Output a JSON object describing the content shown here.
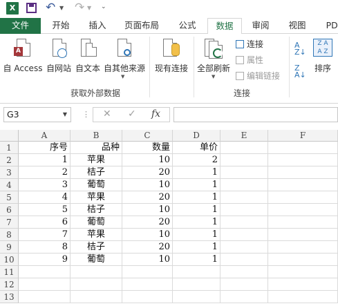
{
  "qat": {
    "logo": "X",
    "customize_glyph": "⌄"
  },
  "tabs": [
    {
      "label": "文件"
    },
    {
      "label": "开始"
    },
    {
      "label": "插入"
    },
    {
      "label": "页面布局"
    },
    {
      "label": "公式"
    },
    {
      "label": "数据"
    },
    {
      "label": "审阅"
    },
    {
      "label": "视图"
    },
    {
      "label": "PDI"
    }
  ],
  "ribbon": {
    "external": {
      "access": "自 Access",
      "web": "自网站",
      "text": "自文本",
      "other": "自其他来源",
      "existing": "现有连接",
      "group_label": "获取外部数据"
    },
    "connections": {
      "refresh": "全部刷新",
      "connections": "连接",
      "properties": "属性",
      "edit_links": "编辑链接",
      "group_label": "连接"
    },
    "sort": {
      "label": "排序"
    }
  },
  "formula_bar": {
    "name_box": "G3",
    "fx": "fx",
    "cancel": "✕",
    "enter": "✓",
    "value": ""
  },
  "grid": {
    "columns": [
      "A",
      "B",
      "C",
      "D",
      "E",
      "F"
    ],
    "row_numbers": [
      "1",
      "2",
      "3",
      "4",
      "5",
      "6",
      "7",
      "8",
      "9",
      "10",
      "11",
      "12",
      "13"
    ],
    "headers": [
      "序号",
      "品种",
      "数量",
      "单价"
    ],
    "rows": [
      [
        "1",
        "苹果",
        "10",
        "2"
      ],
      [
        "2",
        "桔子",
        "20",
        "1"
      ],
      [
        "3",
        "葡萄",
        "10",
        "1"
      ],
      [
        "4",
        "苹果",
        "20",
        "1"
      ],
      [
        "5",
        "桔子",
        "10",
        "1"
      ],
      [
        "6",
        "葡萄",
        "20",
        "1"
      ],
      [
        "7",
        "苹果",
        "10",
        "1"
      ],
      [
        "8",
        "桔子",
        "20",
        "1"
      ],
      [
        "9",
        "葡萄",
        "10",
        "1"
      ]
    ]
  }
}
